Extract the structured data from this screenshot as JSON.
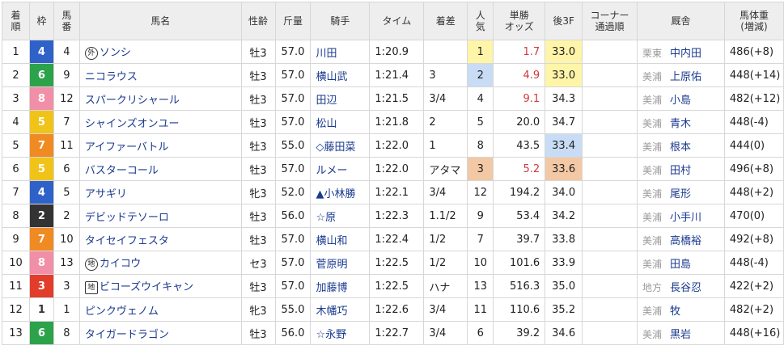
{
  "headers": [
    "着\n順",
    "枠",
    "馬\n番",
    "馬名",
    "性齢",
    "斤量",
    "騎手",
    "タイム",
    "着差",
    "人\n気",
    "単勝\nオッズ",
    "後3F",
    "コーナー\n通過順",
    "厩舎",
    "馬体重\n(増減)"
  ],
  "colors": {
    "waku": {
      "1": "#ffffff",
      "2": "#333333",
      "3": "#e23c2b",
      "4": "#2f62c8",
      "5": "#f0c318",
      "6": "#2ca24a",
      "7": "#f08a22",
      "8": "#f28fa8"
    },
    "pop1_bg": "#fff5a8",
    "pop2_bg": "#c8dcf5",
    "pop3_bg": "#f3c8a4",
    "f3_1_bg": "#fff5a8",
    "f3_2_bg": "#c8dcf5",
    "f3_3_bg": "#f3c8a4"
  },
  "rows": [
    {
      "rank": "1",
      "waku": "4",
      "num": "4",
      "seal": "外",
      "name": "ソンシ",
      "sexage": "牡3",
      "weight": "57.0",
      "jockey": "川田",
      "time": "1:20.9",
      "margin": "",
      "pop": "1",
      "odds": "1.7",
      "last3f": "33.0",
      "corner": "",
      "region": "栗東",
      "trainer": "中内田",
      "bodyweight": "486(+8)",
      "pop_hl": "1",
      "f3_hl": "1",
      "odds_hot": true
    },
    {
      "rank": "2",
      "waku": "6",
      "num": "9",
      "seal": "",
      "name": "ニコラウス",
      "sexage": "牡3",
      "weight": "57.0",
      "jockey": "横山武",
      "time": "1:21.4",
      "margin": "3",
      "pop": "2",
      "odds": "4.9",
      "last3f": "33.0",
      "corner": "",
      "region": "美浦",
      "trainer": "上原佑",
      "bodyweight": "448(+14)",
      "pop_hl": "2",
      "f3_hl": "1",
      "odds_hot": true
    },
    {
      "rank": "3",
      "waku": "8",
      "num": "12",
      "seal": "",
      "name": "スパークリシャール",
      "sexage": "牡3",
      "weight": "57.0",
      "jockey": "田辺",
      "time": "1:21.5",
      "margin": "3/4",
      "pop": "4",
      "odds": "9.1",
      "last3f": "34.3",
      "corner": "",
      "region": "美浦",
      "trainer": "小島",
      "bodyweight": "482(+12)",
      "pop_hl": "",
      "f3_hl": "",
      "odds_hot": true
    },
    {
      "rank": "4",
      "waku": "5",
      "num": "7",
      "seal": "",
      "name": "シャインズオンユー",
      "sexage": "牡3",
      "weight": "57.0",
      "jockey": "松山",
      "time": "1:21.8",
      "margin": "2",
      "pop": "5",
      "odds": "20.0",
      "last3f": "34.7",
      "corner": "",
      "region": "美浦",
      "trainer": "青木",
      "bodyweight": "448(-4)",
      "pop_hl": "",
      "f3_hl": "",
      "odds_hot": false
    },
    {
      "rank": "5",
      "waku": "7",
      "num": "11",
      "seal": "",
      "name": "アイファーバトル",
      "sexage": "牡3",
      "weight": "55.0",
      "jockey": "◇藤田菜",
      "time": "1:22.0",
      "margin": "1",
      "pop": "8",
      "odds": "43.5",
      "last3f": "33.4",
      "corner": "",
      "region": "美浦",
      "trainer": "根本",
      "bodyweight": "444(0)",
      "pop_hl": "",
      "f3_hl": "2",
      "odds_hot": false
    },
    {
      "rank": "6",
      "waku": "5",
      "num": "6",
      "seal": "",
      "name": "バスターコール",
      "sexage": "牡3",
      "weight": "57.0",
      "jockey": "ルメー",
      "time": "1:22.0",
      "margin": "アタマ",
      "pop": "3",
      "odds": "5.2",
      "last3f": "33.6",
      "corner": "",
      "region": "美浦",
      "trainer": "田村",
      "bodyweight": "496(+8)",
      "pop_hl": "3",
      "f3_hl": "3",
      "odds_hot": true
    },
    {
      "rank": "7",
      "waku": "4",
      "num": "5",
      "seal": "",
      "name": "アサギリ",
      "sexage": "牝3",
      "weight": "52.0",
      "jockey": "▲小林勝",
      "time": "1:22.1",
      "margin": "3/4",
      "pop": "12",
      "odds": "194.2",
      "last3f": "34.0",
      "corner": "",
      "region": "美浦",
      "trainer": "尾形",
      "bodyweight": "448(+2)",
      "pop_hl": "",
      "f3_hl": "",
      "odds_hot": false
    },
    {
      "rank": "8",
      "waku": "2",
      "num": "2",
      "seal": "",
      "name": "デビッドテソーロ",
      "sexage": "牡3",
      "weight": "56.0",
      "jockey": "☆原",
      "time": "1:22.3",
      "margin": "1.1/2",
      "pop": "9",
      "odds": "53.4",
      "last3f": "34.2",
      "corner": "",
      "region": "美浦",
      "trainer": "小手川",
      "bodyweight": "470(0)",
      "pop_hl": "",
      "f3_hl": "",
      "odds_hot": false
    },
    {
      "rank": "9",
      "waku": "7",
      "num": "10",
      "seal": "",
      "name": "タイセイフェスタ",
      "sexage": "牡3",
      "weight": "57.0",
      "jockey": "横山和",
      "time": "1:22.4",
      "margin": "1/2",
      "pop": "7",
      "odds": "39.7",
      "last3f": "33.8",
      "corner": "",
      "region": "美浦",
      "trainer": "高橋裕",
      "bodyweight": "492(+8)",
      "pop_hl": "",
      "f3_hl": "",
      "odds_hot": false
    },
    {
      "rank": "10",
      "waku": "8",
      "num": "13",
      "seal": "地",
      "name": "カイコウ",
      "sexage": "セ3",
      "weight": "57.0",
      "jockey": "菅原明",
      "time": "1:22.5",
      "margin": "1/2",
      "pop": "10",
      "odds": "101.6",
      "last3f": "33.9",
      "corner": "",
      "region": "美浦",
      "trainer": "田島",
      "bodyweight": "448(-4)",
      "pop_hl": "",
      "f3_hl": "",
      "odds_hot": false
    },
    {
      "rank": "11",
      "waku": "3",
      "num": "3",
      "seal": "地",
      "name": "ビコーズウイキャン",
      "sexage": "牡3",
      "weight": "57.0",
      "jockey": "加藤博",
      "time": "1:22.5",
      "margin": "ハナ",
      "pop": "13",
      "odds": "516.3",
      "last3f": "35.0",
      "corner": "",
      "region": "地方",
      "trainer": "長谷忍",
      "bodyweight": "422(+2)",
      "pop_hl": "",
      "f3_hl": "",
      "odds_hot": false
    },
    {
      "rank": "12",
      "waku": "1",
      "num": "1",
      "seal": "",
      "name": "ピンクヴェノム",
      "sexage": "牝3",
      "weight": "55.0",
      "jockey": "木幡巧",
      "time": "1:22.6",
      "margin": "3/4",
      "pop": "11",
      "odds": "110.6",
      "last3f": "35.2",
      "corner": "",
      "region": "美浦",
      "trainer": "牧",
      "bodyweight": "482(+2)",
      "pop_hl": "",
      "f3_hl": "",
      "odds_hot": false
    },
    {
      "rank": "13",
      "waku": "6",
      "num": "8",
      "seal": "",
      "name": "タイガードラゴン",
      "sexage": "牡3",
      "weight": "56.0",
      "jockey": "☆永野",
      "time": "1:22.7",
      "margin": "3/4",
      "pop": "6",
      "odds": "39.2",
      "last3f": "34.6",
      "corner": "",
      "region": "美浦",
      "trainer": "黒岩",
      "bodyweight": "448(+16)",
      "pop_hl": "",
      "f3_hl": "",
      "odds_hot": false
    }
  ]
}
